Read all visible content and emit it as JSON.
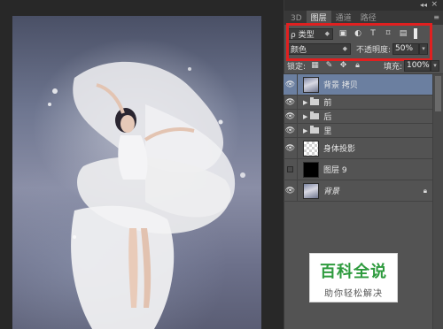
{
  "colors": {
    "highlight": "#e02020",
    "watermark_green": "#2e9b3e",
    "selected_row": "#6b7fa0"
  },
  "panel": {
    "tabs": [
      {
        "label": "3D",
        "active": false
      },
      {
        "label": "图层",
        "active": true
      },
      {
        "label": "通道",
        "active": false
      },
      {
        "label": "路径",
        "active": false
      }
    ],
    "filter": {
      "kind_label": "ρ 类型",
      "icons": [
        "image-filter-icon",
        "adjustment-filter-icon",
        "text-filter-icon",
        "shape-filter-icon",
        "smart-object-filter-icon"
      ],
      "icon_glyphs": [
        "▣",
        "◐",
        "T",
        "⌑",
        "▤"
      ]
    },
    "blend": {
      "mode": "颜色",
      "opacity_label": "不透明度:",
      "opacity_value": "50%"
    },
    "lock": {
      "label": "锁定:",
      "fill_label": "填充:",
      "fill_value": "100%"
    },
    "layers": [
      {
        "name": "背景 拷贝",
        "type": "layer",
        "thumb": "dancer",
        "visible": true,
        "selected": true
      },
      {
        "name": "前",
        "type": "group",
        "visible": true
      },
      {
        "name": "后",
        "type": "group",
        "visible": true
      },
      {
        "name": "里",
        "type": "group",
        "visible": true
      },
      {
        "name": "身体投影",
        "type": "layer",
        "thumb": "trans",
        "visible": true
      },
      {
        "name": "图层 9",
        "type": "layer",
        "thumb": "black",
        "visible": false
      },
      {
        "name": "背景",
        "type": "layer",
        "thumb": "dancer",
        "visible": true,
        "italic": true,
        "locked": true
      }
    ]
  },
  "watermark": {
    "title": "百科全说",
    "subtitle": "助你轻松解决"
  }
}
